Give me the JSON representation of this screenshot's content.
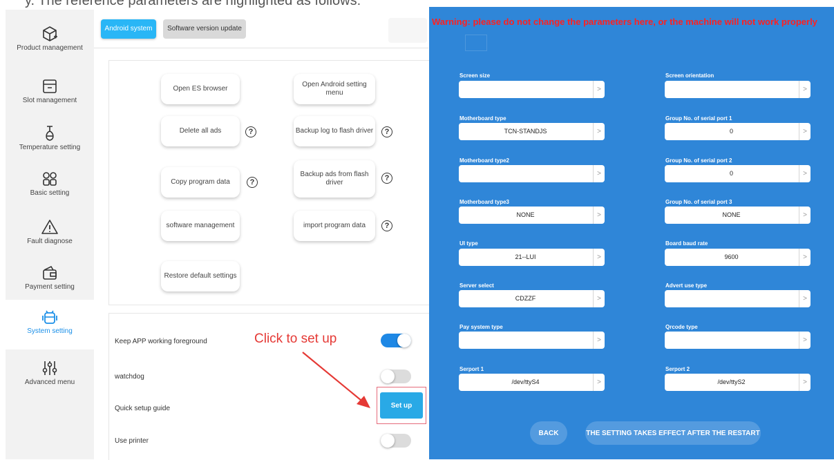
{
  "header_text": "y. The reference parameters are highlighted as follows:",
  "sidebar": [
    {
      "label": "Product management",
      "icon": "box-icon",
      "active": false
    },
    {
      "label": "Slot management",
      "icon": "drawer-icon",
      "active": false
    },
    {
      "label": "Temperature setting",
      "icon": "thermometer-icon",
      "active": false
    },
    {
      "label": "Basic setting",
      "icon": "grid-icon",
      "active": false
    },
    {
      "label": "Fault diagnose",
      "icon": "warning-icon",
      "active": false
    },
    {
      "label": "Payment setting",
      "icon": "wallet-icon",
      "active": false
    },
    {
      "label": "System setting",
      "icon": "android-icon",
      "active": true
    },
    {
      "label": "Advanced menu",
      "icon": "sliders-icon",
      "active": false
    }
  ],
  "tabs": {
    "android": "Android system",
    "software": "Software version update"
  },
  "ops": {
    "open_es": "Open ES browser",
    "open_android": "Open Android setting menu",
    "delete_ads": "Delete all ads",
    "backup_log": "Backup log to flash driver",
    "copy_program": "Copy program data",
    "backup_ads": "Backup ads from flash driver",
    "software_mgmt": "software management",
    "import_program": "import program data",
    "restore": "Restore default settings",
    "help": "?"
  },
  "switches": {
    "keep_app": {
      "label": "Keep APP working foreground",
      "on": true
    },
    "watchdog": {
      "label": "watchdog",
      "on": false
    },
    "quick_setup": {
      "label": "Quick setup guide"
    },
    "printer": {
      "label": "Use printer",
      "on": false
    }
  },
  "setup_button": "Set up",
  "annotation": "Click to set up",
  "colors": {
    "accent": "#29b6f6",
    "panel_blue": "#2f86d8",
    "warning_red": "#ff2020",
    "annotation_red": "#e53935"
  },
  "right": {
    "warning": "Warning: please do not change the parameters here, or the machine will not work properly",
    "fields": {
      "screen_size": {
        "label": "Screen size",
        "value": ""
      },
      "screen_orientation": {
        "label": "Screen orientation",
        "value": ""
      },
      "motherboard_type": {
        "label": "Motherboard type",
        "value": "TCN-STANDJS"
      },
      "group_port1": {
        "label": "Group No. of serial port 1",
        "value": "0"
      },
      "motherboard_type2": {
        "label": "Motherboard type2",
        "value": ""
      },
      "group_port2": {
        "label": "Group No. of serial port 2",
        "value": "0"
      },
      "motherboard_type3": {
        "label": "Motherboard type3",
        "value": "NONE"
      },
      "group_port3": {
        "label": "Group No. of serial port 3",
        "value": "NONE"
      },
      "ui_type": {
        "label": "UI type",
        "value": "21--LUI"
      },
      "baud_rate": {
        "label": "Board baud rate",
        "value": "9600"
      },
      "server_select": {
        "label": "Server select",
        "value": "CDZZF"
      },
      "advert_type": {
        "label": "Advert use type",
        "value": ""
      },
      "pay_system": {
        "label": "Pay system type",
        "value": ""
      },
      "qrcode_type": {
        "label": "Qrcode type",
        "value": ""
      },
      "serport1": {
        "label": "Serport 1",
        "value": "/dev/ttyS4"
      },
      "serport2": {
        "label": "Serport 2",
        "value": "/dev/ttyS2"
      }
    },
    "arrow": ">",
    "back": "BACK",
    "restart": "THE SETTING TAKES EFFECT AFTER THE RESTART"
  }
}
